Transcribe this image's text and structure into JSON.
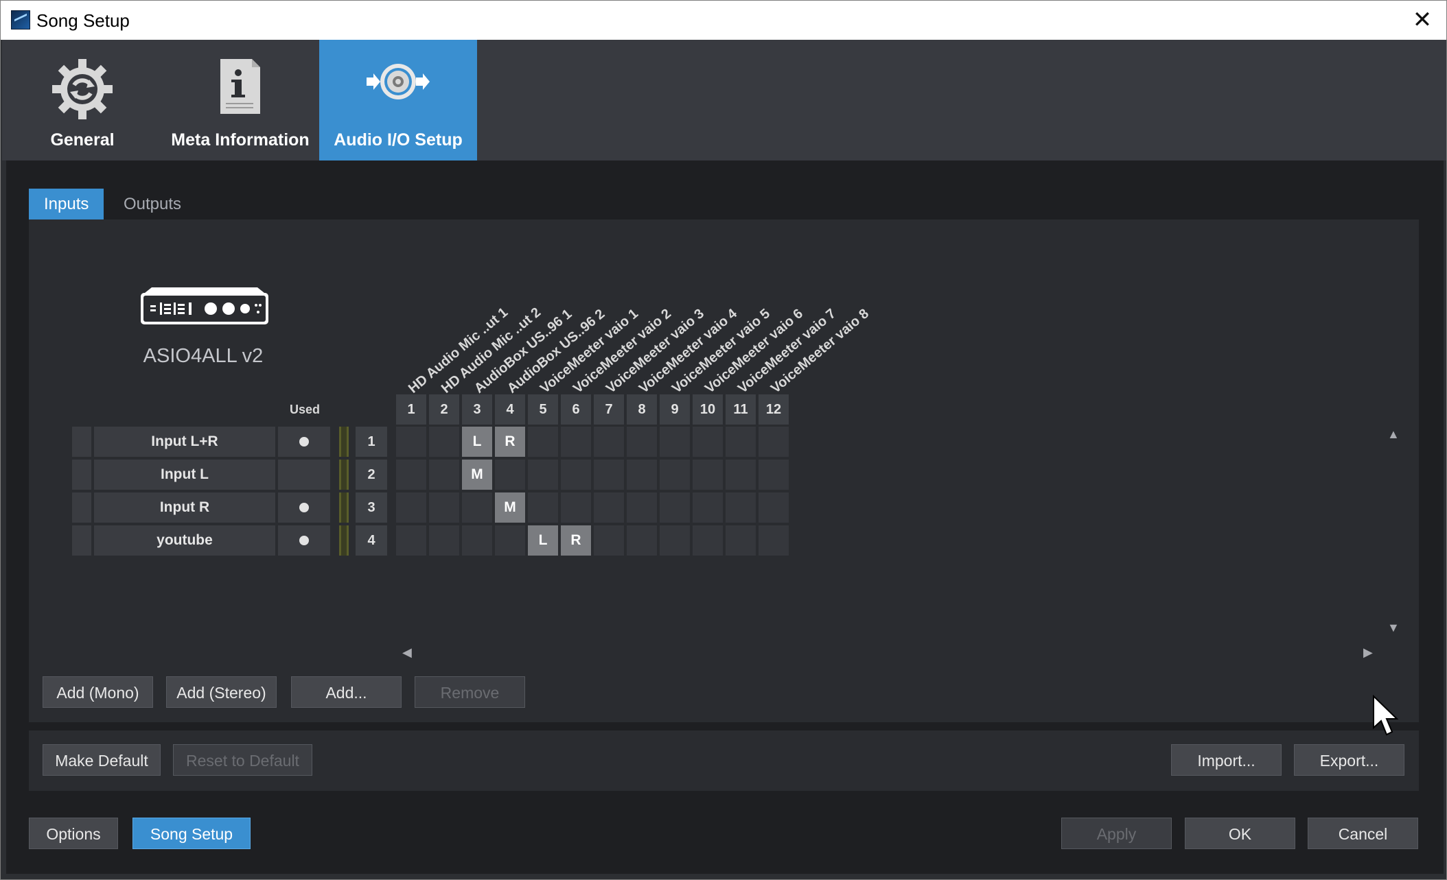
{
  "window": {
    "title": "Song Setup",
    "close_glyph": "✕"
  },
  "top_tabs": [
    {
      "label": "General",
      "icon": "gear-icon"
    },
    {
      "label": "Meta Information",
      "icon": "info-document-icon"
    },
    {
      "label": "Audio I/O Setup",
      "icon": "speaker-io-icon",
      "active": true
    }
  ],
  "sub_tabs": [
    {
      "label": "Inputs",
      "active": true
    },
    {
      "label": "Outputs",
      "active": false
    }
  ],
  "device": {
    "name": "ASIO4ALL v2",
    "icon": "audio-interface-icon"
  },
  "matrix": {
    "used_header": "Used",
    "columns": [
      {
        "num": "1",
        "name": "HD Audio Mic ..ut 1"
      },
      {
        "num": "2",
        "name": "HD Audio Mic ..ut 2"
      },
      {
        "num": "3",
        "name": "AudioBox US..96 1"
      },
      {
        "num": "4",
        "name": "AudioBox US..96 2"
      },
      {
        "num": "5",
        "name": "VoiceMeeter vaio 1"
      },
      {
        "num": "6",
        "name": "VoiceMeeter vaio 2"
      },
      {
        "num": "7",
        "name": "VoiceMeeter vaio 3"
      },
      {
        "num": "8",
        "name": "VoiceMeeter vaio 4"
      },
      {
        "num": "9",
        "name": "VoiceMeeter vaio 5"
      },
      {
        "num": "10",
        "name": "VoiceMeeter vaio 6"
      },
      {
        "num": "11",
        "name": "VoiceMeeter vaio 7"
      },
      {
        "num": "12",
        "name": "VoiceMeeter vaio 8"
      }
    ],
    "rows": [
      {
        "name": "Input L+R",
        "num": "1",
        "used": true,
        "cells": {
          "3": "L",
          "4": "R"
        }
      },
      {
        "name": "Input L",
        "num": "2",
        "used": false,
        "cells": {
          "3": "M"
        }
      },
      {
        "name": "Input R",
        "num": "3",
        "used": true,
        "cells": {
          "4": "M"
        }
      },
      {
        "name": "youtube",
        "num": "4",
        "used": true,
        "cells": {
          "5": "L",
          "6": "R"
        }
      }
    ]
  },
  "channel_buttons": {
    "add_mono": "Add (Mono)",
    "add_stereo": "Add (Stereo)",
    "add": "Add...",
    "remove": "Remove"
  },
  "default_buttons": {
    "make_default": "Make Default",
    "reset_default": "Reset to Default",
    "import": "Import...",
    "export": "Export..."
  },
  "footer": {
    "options": "Options",
    "song_setup": "Song Setup",
    "apply": "Apply",
    "ok": "OK",
    "cancel": "Cancel"
  },
  "scroll_glyphs": {
    "up": "▲",
    "down": "▼",
    "left": "◀",
    "right": "▶"
  }
}
